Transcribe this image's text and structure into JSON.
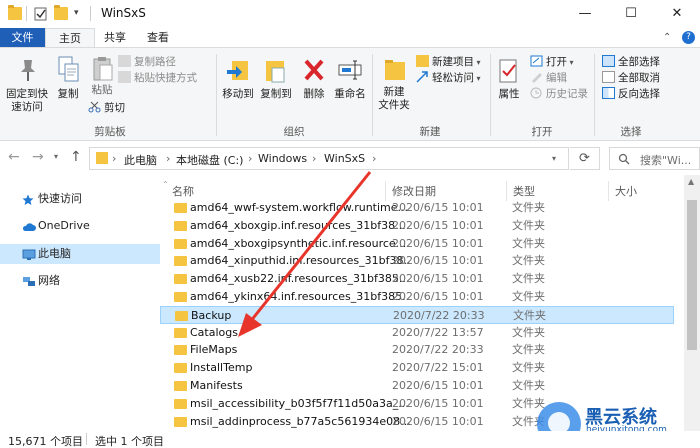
{
  "window": {
    "title": "WinSxS",
    "controls": {
      "minimize": "—",
      "maximize": "☐",
      "close": "✕"
    }
  },
  "ribbon": {
    "tabs": [
      {
        "label": "文件"
      },
      {
        "label": "主页"
      },
      {
        "label": "共享"
      },
      {
        "label": "查看"
      }
    ],
    "clipboard": {
      "pin": "固定到快\n速访问",
      "copy": "复制",
      "paste": "粘贴",
      "copy_path": "复制路径",
      "paste_shortcut": "粘贴快捷方式",
      "cut": "剪切",
      "group": "剪贴板"
    },
    "organize": {
      "move_to": "移动到",
      "copy_to": "复制到",
      "delete": "删除",
      "rename": "重命名",
      "group": "组织"
    },
    "new": {
      "new_folder": "新建\n文件夹",
      "new_item": "新建项目",
      "easy_access": "轻松访问",
      "group": "新建"
    },
    "open": {
      "properties": "属性",
      "open": "打开",
      "edit": "编辑",
      "history": "历史记录",
      "group": "打开"
    },
    "select": {
      "select_all": "全部选择",
      "select_none": "全部取消",
      "invert": "反向选择",
      "group": "选择"
    },
    "expand_icon": "chevron-up-icon",
    "help_icon": "help-icon"
  },
  "address": {
    "crumbs": [
      "此电脑",
      "本地磁盘 (C:)",
      "Windows",
      "WinSxS"
    ],
    "search_placeholder": "搜索\"Wi..."
  },
  "nav_pane": {
    "items": [
      {
        "label": "快速访问",
        "icon": "star-icon"
      },
      {
        "label": "OneDrive",
        "icon": "cloud-icon"
      },
      {
        "label": "此电脑",
        "icon": "computer-icon"
      },
      {
        "label": "网络",
        "icon": "network-icon"
      }
    ]
  },
  "file_list": {
    "columns": {
      "name": "名称",
      "date": "修改日期",
      "type": "类型",
      "size": "大小"
    },
    "rows": [
      {
        "name": "amd64_wwf-system.workflow.runtime...",
        "date": "2020/6/15 10:01",
        "type": "文件夹"
      },
      {
        "name": "amd64_xboxgip.inf.resources_31bf38...",
        "date": "2020/6/15 10:01",
        "type": "文件夹"
      },
      {
        "name": "amd64_xboxgipsynthetic.inf.resource...",
        "date": "2020/6/15 10:01",
        "type": "文件夹"
      },
      {
        "name": "amd64_xinputhid.inf.resources_31bf38...",
        "date": "2020/6/15 10:01",
        "type": "文件夹"
      },
      {
        "name": "amd64_xusb22.inf.resources_31bf385...",
        "date": "2020/6/15 10:01",
        "type": "文件夹"
      },
      {
        "name": "amd64_ykinx64.inf.resources_31bf385...",
        "date": "2020/6/15 10:01",
        "type": "文件夹"
      },
      {
        "name": "Backup",
        "date": "2020/7/22 20:33",
        "type": "文件夹"
      },
      {
        "name": "Catalogs",
        "date": "2020/7/22 13:57",
        "type": "文件夹"
      },
      {
        "name": "FileMaps",
        "date": "2020/7/22 20:33",
        "type": "文件夹"
      },
      {
        "name": "InstallTemp",
        "date": "2020/7/22 15:01",
        "type": "文件夹"
      },
      {
        "name": "Manifests",
        "date": "2020/6/15 10:01",
        "type": "文件夹"
      },
      {
        "name": "msil_accessibility_b03f5f7f11d50a3a_...",
        "date": "2020/6/15 10:01",
        "type": "文件夹"
      },
      {
        "name": "msil_addinprocess_b77a5c561934e08...",
        "date": "2020/6/15 10:01",
        "type": "文件夹"
      }
    ]
  },
  "status": {
    "count": "15,671 个项目",
    "selected": "选中 1 个项目"
  },
  "watermark": {
    "brand": "黑云系统",
    "url": "heiyunxitong.com"
  },
  "colors": {
    "accent": "#1f5fb8",
    "selection": "#cce8ff",
    "folder": "#f5c542",
    "arrow": "#e8352b"
  }
}
